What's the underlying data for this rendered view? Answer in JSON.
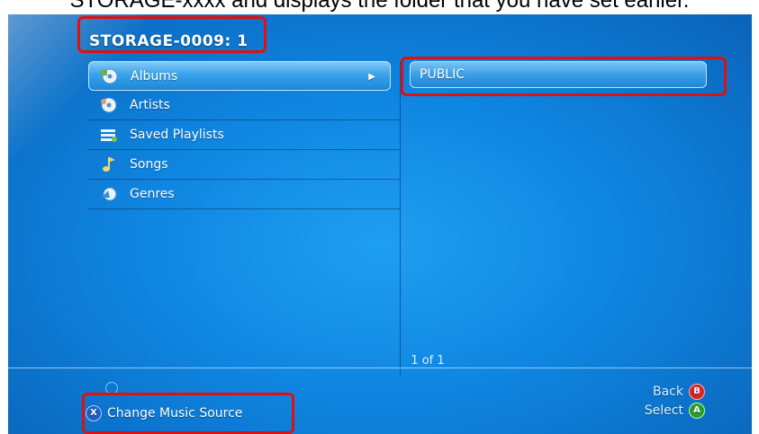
{
  "caption": "STORAGE-xxxx and displays the folder that you have set earlier.",
  "header": {
    "title": "STORAGE-0009: 1"
  },
  "menu": {
    "items": [
      {
        "label": "Albums",
        "icon": "album-disc-icon",
        "selected": true
      },
      {
        "label": "Artists",
        "icon": "artist-disc-icon",
        "selected": false
      },
      {
        "label": "Saved Playlists",
        "icon": "playlist-icon",
        "selected": false
      },
      {
        "label": "Songs",
        "icon": "music-note-icon",
        "selected": false
      },
      {
        "label": "Genres",
        "icon": "genre-icon",
        "selected": false
      }
    ]
  },
  "folders": {
    "items": [
      {
        "label": "PUBLIC"
      }
    ]
  },
  "pager": {
    "text": "1 of 1"
  },
  "footer": {
    "x_glyph": "X",
    "change_source_label": "Change Music Source",
    "back_label": "Back",
    "back_glyph": "B",
    "select_label": "Select",
    "select_glyph": "A"
  },
  "colors": {
    "background": "#0f86e1",
    "highlight": "#e01010",
    "selected_item": "#3aa2ea"
  }
}
